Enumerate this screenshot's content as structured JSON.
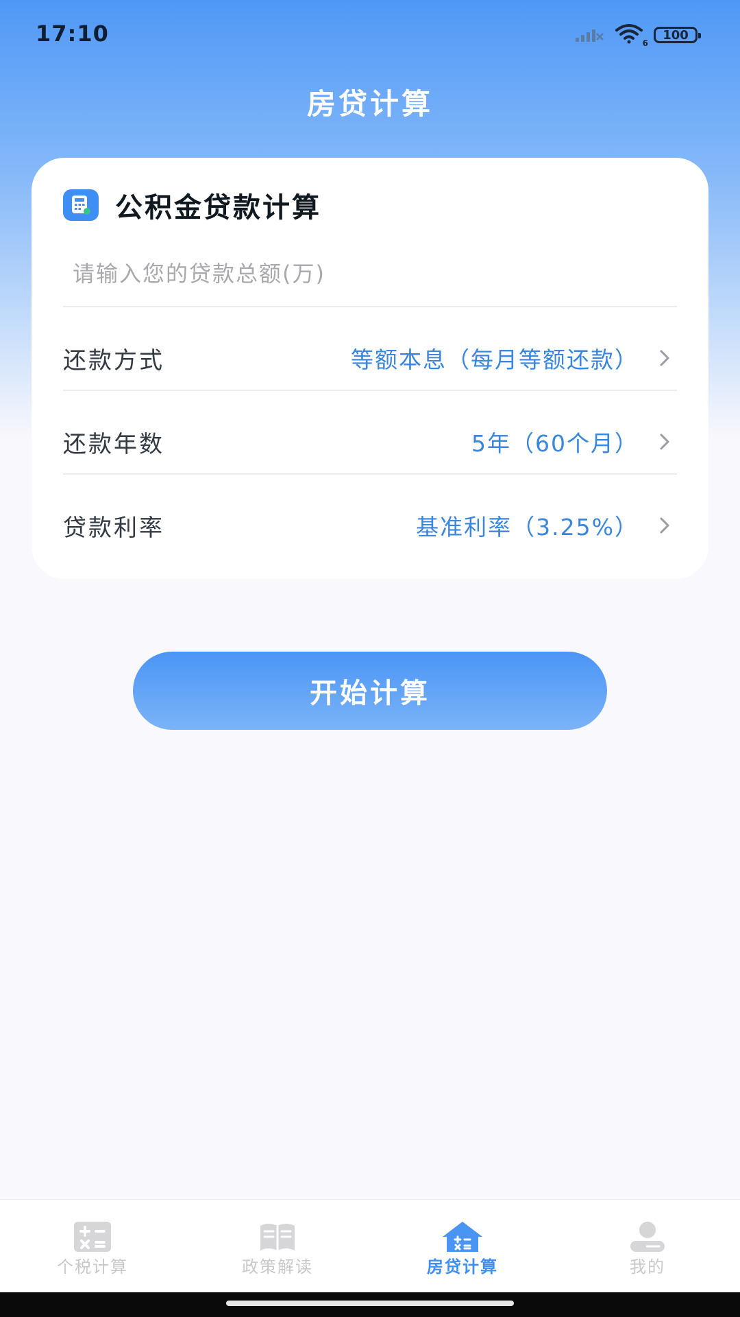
{
  "status_bar": {
    "time": "17:10",
    "battery": "100",
    "wifi_badge": "6"
  },
  "header": {
    "title": "房贷计算"
  },
  "card": {
    "title": "公积金贷款计算",
    "icon": "calculator-icon",
    "amount_placeholder": "请输入您的贷款总额(万)",
    "rows": [
      {
        "label": "还款方式",
        "value": "等额本息（每月等额还款）"
      },
      {
        "label": "还款年数",
        "value": "5年（60个月）"
      },
      {
        "label": "贷款利率",
        "value": "基准利率（3.25%）"
      }
    ]
  },
  "actions": {
    "start_label": "开始计算"
  },
  "bottom_nav": {
    "items": [
      {
        "label": "个税计算",
        "icon": "calculator-icon",
        "active": false
      },
      {
        "label": "政策解读",
        "icon": "book-icon",
        "active": false
      },
      {
        "label": "房贷计算",
        "icon": "house-icon",
        "active": true
      },
      {
        "label": "我的",
        "icon": "user-icon",
        "active": false
      }
    ]
  },
  "colors": {
    "primary": "#3f8ef4",
    "value_text": "#3a86db",
    "inactive_nav": "#c9c9cc"
  }
}
